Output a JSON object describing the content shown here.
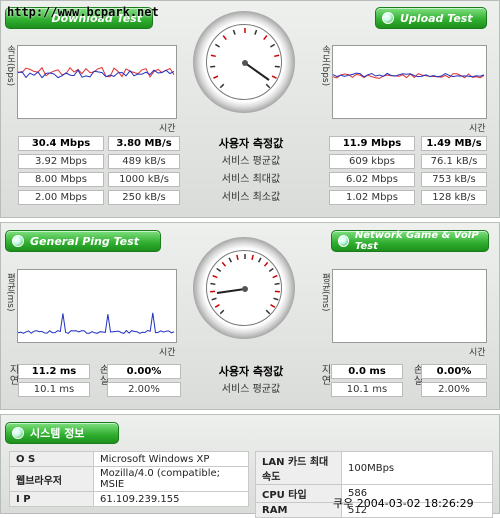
{
  "watermark": "http://www.bcpark.net",
  "top": {
    "download_button": "Download Test",
    "upload_button": "Upload Test",
    "axis_speed": "속도(bps)",
    "axis_time": "시간",
    "center_labels": [
      "사용자 측정값",
      "서비스 평균값",
      "서비스 최대값",
      "서비스 최소값"
    ],
    "download_rows": [
      [
        "30.4 Mbps",
        "3.80 MB/s"
      ],
      [
        "3.92 Mbps",
        "489 kB/s"
      ],
      [
        "8.00 Mbps",
        "1000 kB/s"
      ],
      [
        "2.00 Mbps",
        "250 kB/s"
      ]
    ],
    "upload_rows": [
      [
        "11.9 Mbps",
        "1.49 MB/s"
      ],
      [
        "609 kbps",
        "76.1 kB/s"
      ],
      [
        "6.02 Mbps",
        "753 kB/s"
      ],
      [
        "1.02 Mbps",
        "128 kB/s"
      ]
    ],
    "gauge_ticks": [
      "100K",
      "500K",
      "1M",
      "5M",
      "10M",
      "20M",
      "50M",
      "100M"
    ]
  },
  "bottom": {
    "ping_button": "General Ping Test",
    "game_button": "Network Game & VoIP Test",
    "axis_ping": "평균(ms)",
    "axis_time": "시간",
    "center_labels": [
      "사용자 측정값",
      "서비스 평균값"
    ],
    "left_side_a": "지연",
    "left_side_b": "손실",
    "ping_rows": [
      [
        "11.2 ms",
        "0.00%"
      ],
      [
        "10.1 ms",
        "2.00%"
      ]
    ],
    "game_rows": [
      [
        "0.0 ms",
        "0.00%"
      ],
      [
        "10.1 ms",
        "2.00%"
      ]
    ],
    "gauge_ticks": [
      "0",
      "10",
      "20",
      "30",
      "40",
      "50",
      "60",
      "70",
      "80",
      "90",
      "100"
    ]
  },
  "system": {
    "title": "시스템 정보",
    "left": [
      [
        "O S",
        "Microsoft Windows XP"
      ],
      [
        "웹브라우저",
        "Mozilla/4.0 (compatible; MSIE"
      ],
      [
        "I P",
        "61.109.239.155"
      ]
    ],
    "right": [
      [
        "LAN 카드 최대 속도",
        "100MBps"
      ],
      [
        "CPU 타입",
        "586"
      ],
      [
        "RAM",
        "512"
      ]
    ]
  },
  "timestamp": "2004-03-02 18:26:29",
  "timestamp_prefix": "쿠우",
  "colors": {
    "accent_green": "#2fae2f",
    "line_red": "#e03030",
    "line_blue": "#2030c0"
  }
}
